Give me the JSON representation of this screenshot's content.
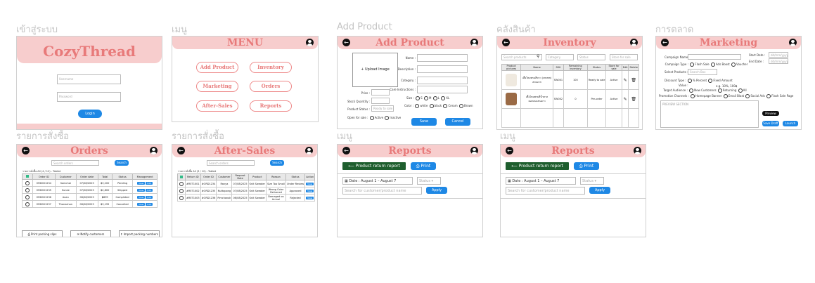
{
  "captions": {
    "login": "เข้าสู่ระบบ",
    "menu": "เมนู",
    "add_product": "Add Product",
    "inventory": "คลังสินค้า",
    "marketing": "การตลาด",
    "orders": "รายการสั่งซื้อ",
    "after_sales": "รายการสั่งซื้อ",
    "reports1": "เมนู",
    "reports2": "เมนู"
  },
  "login": {
    "brand": "CozyThread",
    "username_placeholder": "Username",
    "password_placeholder": "Password",
    "login_label": "Login"
  },
  "menu": {
    "title": "MENU",
    "items": [
      "Add Product",
      "Inventory",
      "Marketing",
      "Orders",
      "After-Sales",
      "Reports"
    ]
  },
  "add_product": {
    "title": "Add Product",
    "upload": "+ Upload Image",
    "fields": [
      "Name :",
      "Description :",
      "Category :",
      "Care Instructions :"
    ],
    "price": "Price :",
    "stock": "Stock Quantity :",
    "status": "Product Status :",
    "status_value": "Ready to sale",
    "open_sale": "Open for sale :",
    "active": "Active",
    "inactive": "Inactive",
    "size": "Size :",
    "sizes": [
      "S",
      "M",
      "L",
      "XL"
    ],
    "color": "Color :",
    "colors": [
      "white",
      "black",
      "Cream",
      "Brown"
    ],
    "save": "Save",
    "cancel": "Cancel"
  },
  "inventory": {
    "title": "Inventory",
    "search": "Search products",
    "filter1": "Category",
    "filter2": "Status",
    "filter3": "Store for sale",
    "columns": [
      "Product pictures",
      "Name",
      "SKU",
      "Remaining inventory",
      "Status",
      "Store for sale",
      "Edit",
      "Delete"
    ],
    "rows": [
      [
        "",
        "เสื้อไหมพรมสีขาว (cream) สวยมาก",
        "SW001",
        "100",
        "Ready to sale",
        "Active"
      ],
      [
        "",
        "เสื้อไหมพรมสีน้ำตาล คอกลมแขนยาว",
        "SW002",
        "0",
        "Pre-order",
        "Active"
      ]
    ]
  },
  "marketing": {
    "title": "Marketing",
    "campaign_name": "Campaign Name :",
    "campaign_type": "Campaign Type :",
    "types": [
      "Flash Sale",
      "Ads Boost",
      "Voucher"
    ],
    "select_products": "Select Products :",
    "search_box": "Search Box",
    "discount_type": "Discount Type :",
    "discounts": [
      "% Percent",
      "Fixed Amount"
    ],
    "value": "Value :",
    "value_hint": "e.g. 10%, 100฿",
    "target": "Target Audience :",
    "targets": [
      "New Customers",
      "Returning",
      "All"
    ],
    "channels": "Promotion Channels :",
    "channel_list": [
      "Homepage Banner",
      "Email Blast",
      "Social Ads",
      "Flash Sale Page"
    ],
    "start": "Start Date :",
    "end": "End Date :",
    "date_value": "dd/mm/yyyy",
    "preview": "PREVIEW SECTION",
    "preview_btn": "Preview",
    "save_draft": "Save Draft",
    "launch": "Launch"
  },
  "orders": {
    "title": "Orders",
    "search": "Search orders",
    "search_btn": "Search",
    "table_title": "รายการสั่งซื้อ All (4 / 12) - Tabled",
    "columns": [
      "",
      "Order ID",
      "Customer",
      "Order date",
      "Total",
      "Status",
      "Management"
    ],
    "rows": [
      [
        "ORD001234",
        "Somchai",
        "07/08/2025",
        "฿3,200",
        "Pending"
      ],
      [
        "ORD001235",
        "Sunee",
        "07/08/2025",
        "฿2,800",
        "Shipped"
      ],
      [
        "ORD001236",
        "Anan",
        "06/08/2025",
        "฿899",
        "Completed"
      ],
      [
        "ORD001237",
        "Thanachon",
        "06/08/2025",
        "฿3,195",
        "Cancelled"
      ]
    ],
    "view": "View",
    "edit": "Edit",
    "footer": [
      "Print packing slips",
      "Notify customers",
      "Import packing numbers"
    ]
  },
  "after_sales": {
    "title": "After-Sales",
    "search": "Search orders",
    "search_btn": "Search",
    "table_title": "รายการสั่งซื้อ All (3 / 12) - Tabled",
    "columns": [
      "",
      "Return ID",
      "Order ID",
      "Customer",
      "Request Date",
      "Product",
      "Reason",
      "Status",
      "Action"
    ],
    "rows": [
      [
        "#RET1001",
        "#ORD1234",
        "Ranya",
        "07/08/2025",
        "Knit Sweater",
        "Size Too Small",
        "Under Review"
      ],
      [
        "#RET1002",
        "#ORD1235",
        "Nuttapong",
        "07/08/2025",
        "Knit Sweater",
        "Wrong Color Delivered",
        "Approved"
      ],
      [
        "#RET1003",
        "#ORD1236",
        "Pimchanok",
        "06/08/2025",
        "Knit Sweater",
        "Damaged on Arrival",
        "Rejected"
      ]
    ],
    "view": "View"
  },
  "reports": {
    "title": "Reports",
    "return_report": "Product return report",
    "print": "Print",
    "date": "Date : August 1 – August 7",
    "status": "Status",
    "search": "Search for customer/product name",
    "apply": "Apply"
  }
}
